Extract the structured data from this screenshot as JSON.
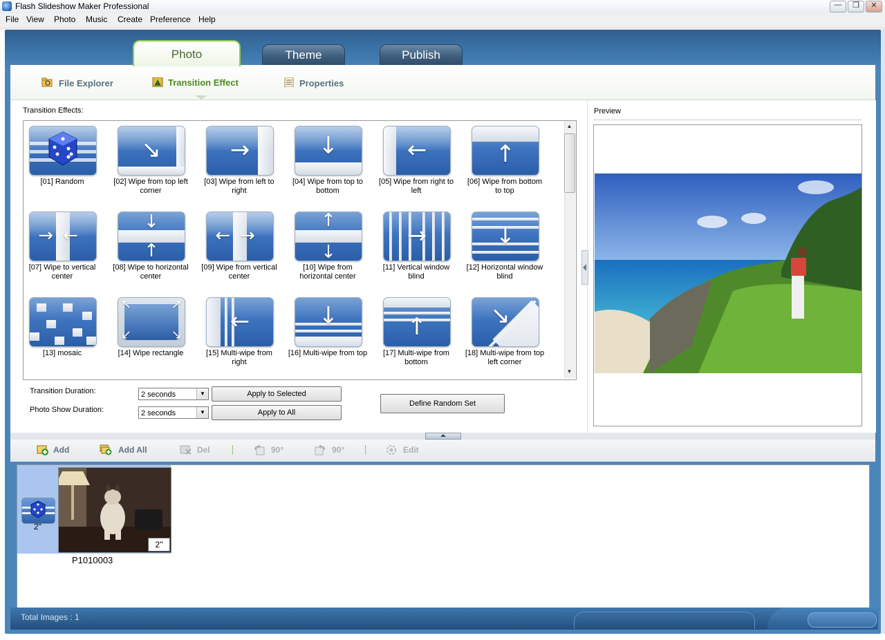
{
  "window": {
    "title": "Flash Slideshow Maker Professional"
  },
  "menu": [
    "File",
    "View",
    "Photo",
    "Music",
    "Create",
    "Preference",
    "Help"
  ],
  "main_tabs": [
    "Photo",
    "Theme",
    "Publish"
  ],
  "sub_tabs": [
    "File Explorer",
    "Transition Effect",
    "Properties"
  ],
  "transitions": {
    "label": "Transition Effects:",
    "items": [
      "[01] Random",
      "[02] Wipe from top left corner",
      "[03] Wipe from left to right",
      "[04] Wipe from top to bottom",
      "[05] Wipe from right to left",
      "[06] Wipe from bottom to top",
      "[07] Wipe to vertical center",
      "[08] Wipe to horizontal center",
      "[09] Wipe from vertical center",
      "[10] Wipe from horizontal center",
      "[11] Vertical window blind",
      "[12] Horizontal window blind",
      "[13] mosaic",
      "[14] Wipe rectangle",
      "[15] Multi-wipe from right",
      "[16] Multi-wipe from top",
      "[17] Multi-wipe from bottom",
      "[18] Multi-wipe from top left corner"
    ]
  },
  "controls": {
    "transition_duration_label": "Transition Duration:",
    "photo_show_duration_label": "Photo Show Duration:",
    "transition_duration_value": "2 seconds",
    "photo_show_duration_value": "2 seconds",
    "apply_selected": "Apply to Selected",
    "apply_all": "Apply to All",
    "define_random": "Define Random Set"
  },
  "preview": {
    "label": "Preview"
  },
  "toolbar": {
    "add": "Add",
    "add_all": "Add All",
    "del": "Del",
    "rotate_left": "90°",
    "rotate_right": "90°",
    "edit": "Edit"
  },
  "storyboard": {
    "transition_duration": "2\"",
    "photo_duration": "2\"",
    "photo_name": "P1010003"
  },
  "status": {
    "text": "Total Images : 1"
  }
}
